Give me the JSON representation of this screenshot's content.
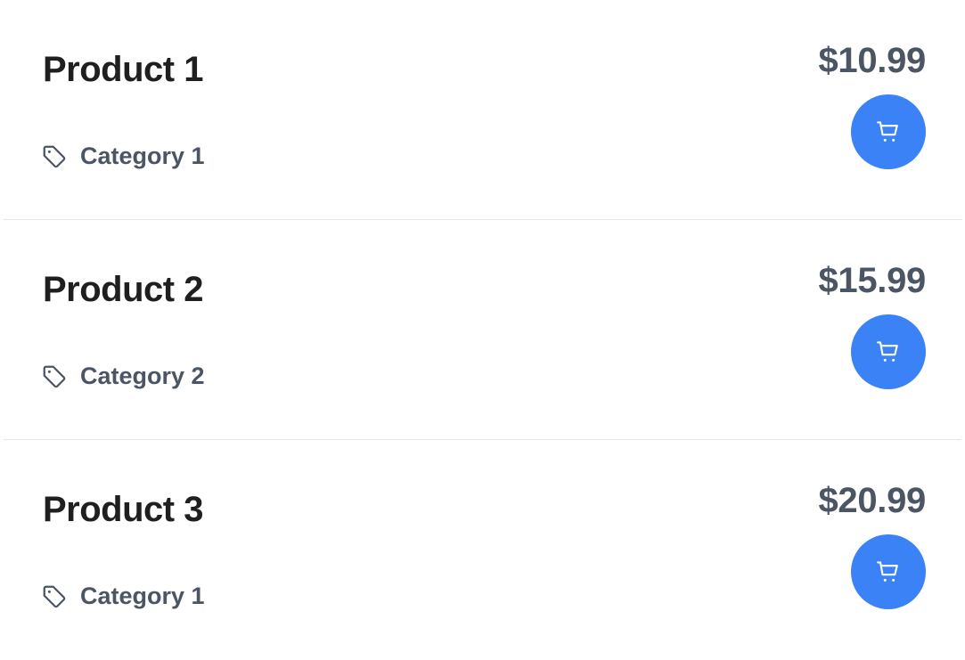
{
  "colors": {
    "accent": "#3b82f6",
    "title_text": "#1f1f1f",
    "secondary_text": "#4b5563",
    "divider": "#e5e7eb"
  },
  "icons": {
    "category": "tag-icon",
    "cart": "shopping-cart-icon"
  },
  "products": [
    {
      "name": "Product 1",
      "category": "Category 1",
      "price": "$10.99"
    },
    {
      "name": "Product 2",
      "category": "Category 2",
      "price": "$15.99"
    },
    {
      "name": "Product 3",
      "category": "Category 1",
      "price": "$20.99"
    }
  ]
}
